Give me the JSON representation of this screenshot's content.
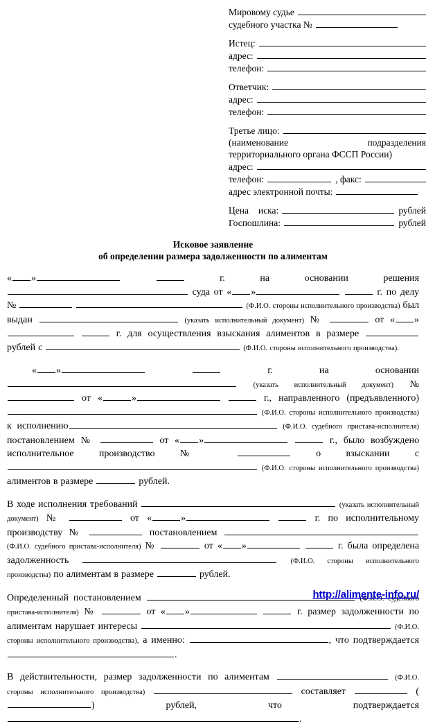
{
  "document": {
    "title_line1": "Исковое заявление",
    "title_line2": "об определении размера задолженности по алиментам"
  },
  "header": {
    "court": {
      "label": "Мировому судье",
      "district_label": "судебного участка №"
    },
    "plaintiff": {
      "label": "Истец:",
      "address_label": "адрес:",
      "phone_label": "телефон:"
    },
    "defendant": {
      "label": "Ответчик:",
      "address_label": "адрес:",
      "phone_label": "телефон:"
    },
    "third_party": {
      "label": "Третье лицо:",
      "description_line1": "(наименование",
      "description_line1b": "подразделения",
      "description_line2": "территориального органа ФССП России)",
      "address_label": "адрес:",
      "phone_label": "телефон:",
      "fax_label": ", факс:",
      "email_label": "адрес электронной почты:"
    },
    "claim": {
      "price_label": "Цена",
      "price_label2": "иска:",
      "price_unit": "рублей",
      "fee_label": "Госпошлина:",
      "fee_unit": "рублей"
    }
  },
  "body": {
    "p1": {
      "s1": "«",
      "s2": "»",
      "s3": "г.",
      "s4": "на",
      "s5": "основании",
      "s6": "решения",
      "s7": "суда",
      "s8": "от",
      "s9": "«",
      "s10": "»",
      "s11": "г.",
      "s12": "по",
      "s13": "делу",
      "s14": "№",
      "note1": "(Ф.И.О. стороны исполнительного производства)",
      "s15": "был",
      "s16": "выдан",
      "note2": "(указать исполнительный документ)",
      "s17": "№",
      "s18": "от",
      "s19": "«",
      "s20": "»",
      "s21": "г. для осуществления взыскания алиментов в размере",
      "s22": "рублей с",
      "note3": "(Ф.И.О. стороны исполнительного производства)."
    },
    "p2": {
      "s1": "«",
      "s2": "»",
      "s3": "г. на основании",
      "note1": "(указать исполнительный документ)",
      "s4": "№",
      "s5": "от",
      "s6": "«",
      "s7": "»",
      "s8": "г.,",
      "s9": "направленного (предъявленного)",
      "note2": "(Ф.И.О. стороны исполнительного производства)",
      "s10": "к",
      "s11": "исполнению",
      "note3": "(Ф.И.О. судебного пристава-исполнителя)",
      "s12": "постановлением",
      "s13": "№",
      "s14": "от",
      "s15": "«",
      "s16": "»",
      "s17": "г.,",
      "s18": "было возбуждено исполнительное производство",
      "s19": "№",
      "s20": "о",
      "s21": "взыскании",
      "s22": "с",
      "note4": "(Ф.И.О. стороны исполнительного производства)",
      "s23": "алиментов в размере",
      "s24": "рублей."
    },
    "p3": {
      "s1": "В ходе исполнения требований",
      "note1": "(указать исполнительный документ)",
      "s2": "№",
      "s3": "от",
      "s4": "«",
      "s5": "»",
      "s6": "г. по исполнительному производству",
      "s7": "№",
      "s8": "постановлением",
      "note2": "(Ф.И.О. судебного пристава-исполнителя)",
      "s9": "№",
      "s10": "от",
      "s11": "«",
      "s12": "»",
      "s13": "г.",
      "s14": "была",
      "s15": "определена",
      "s16": "задолженность",
      "note3": "(Ф.И.О. стороны исполнительного производства)",
      "s17": "по алиментам в размере",
      "s18": "рублей."
    },
    "p4": {
      "s1": "Определенный постановлением",
      "note1": "(Ф.И.О. судебного пристава-исполнителя)",
      "s2": "№",
      "s3": "от",
      "s4": "«",
      "s5": "»",
      "s6": "г. размер задолженности по алиментам нарушает интересы",
      "note2": "(Ф.И.О. стороны исполнительного производства),",
      "s7": "а",
      "s8": "именно:",
      "s9": ",",
      "s10": "что",
      "s11": "подтверждается",
      "s12": "."
    },
    "p5": {
      "s1": "В действительности, размер задолженности по алиментам",
      "note1": "(Ф.И.О. стороны исполнительного производства)",
      "s2": "составляет",
      "s3": "(",
      "s4": ")",
      "s5": "рублей, что подтверждается",
      "s6": "."
    }
  },
  "footer": {
    "watermark_url": "http://alimente-info.ru/"
  }
}
